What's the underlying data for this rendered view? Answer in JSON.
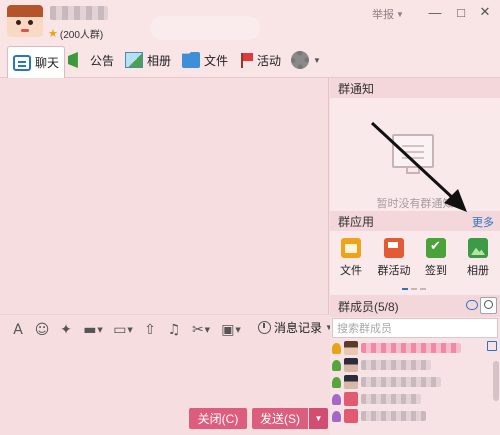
{
  "titlebar": {
    "member_count": "(200人群)",
    "report_label": "举报",
    "minimize": "—",
    "maximize": "□",
    "close": "✕"
  },
  "tabs": [
    {
      "label": "聊天",
      "icon": "chat-icon",
      "active": true
    },
    {
      "label": "公告",
      "icon": "announcement-icon"
    },
    {
      "label": "相册",
      "icon": "photo-icon"
    },
    {
      "label": "文件",
      "icon": "folder-icon"
    },
    {
      "label": "活动",
      "icon": "flag-icon"
    },
    {
      "label": "",
      "icon": "gear-icon"
    }
  ],
  "input_toolbar": {
    "history_label": "消息记录",
    "tools": [
      "font-icon",
      "emoji-icon",
      "magic-icon",
      "gift-icon",
      "image-icon",
      "upload-icon",
      "music-icon",
      "screenshot-icon",
      "more-tools-icon"
    ]
  },
  "buttons": {
    "close_label": "关闭(C)",
    "send_label": "发送(S)"
  },
  "sidebar": {
    "notice_title": "群通知",
    "notice_empty": "暂时没有群通知",
    "apps_title": "群应用",
    "more_label": "更多",
    "apps": [
      {
        "label": "文件",
        "icon": "folder-app-icon"
      },
      {
        "label": "群活动",
        "icon": "activity-app-icon"
      },
      {
        "label": "签到",
        "icon": "checkin-app-icon"
      },
      {
        "label": "相册",
        "icon": "album-app-icon"
      }
    ],
    "members_title": "群成员(5/8)",
    "member_search_placeholder": "搜索群成员"
  },
  "colors": {
    "accent": "#dd5d7f",
    "link": "#2a73c6",
    "background": "#f6dde0"
  }
}
